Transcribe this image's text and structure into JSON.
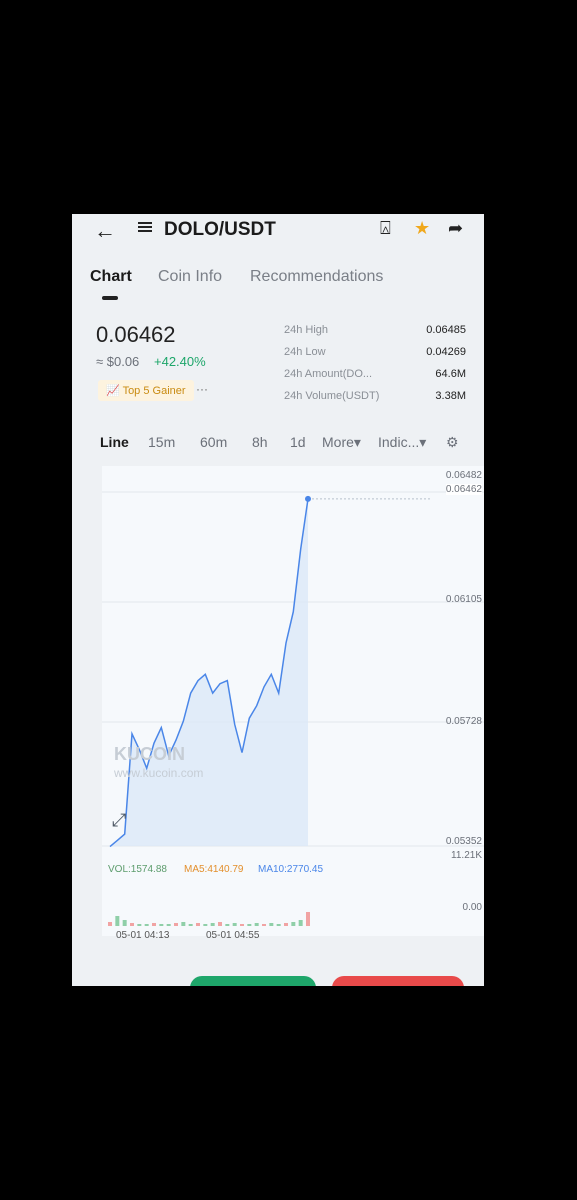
{
  "header": {
    "back_icon": "arrow-left-icon",
    "menu_icon": "hamburger-icon",
    "pair": "DOLO/USDT",
    "alert_icon": "bell-alert-icon",
    "favorite_icon": "star-icon",
    "share_icon": "share-icon",
    "favorite_color": "#f0a81c"
  },
  "tabs": [
    "Chart",
    "Coin Info",
    "Recommendations"
  ],
  "ticker": {
    "price": "0.06462",
    "fiat": "≈ $0.06",
    "change": "+42.40%",
    "badge": "Top 5 Gainer",
    "more": "···"
  },
  "stats": [
    {
      "label": "24h High",
      "value": "0.06485"
    },
    {
      "label": "24h Low",
      "value": "0.04269"
    },
    {
      "label": "24h Amount(DO...",
      "value": "64.6M"
    },
    {
      "label": "24h Volume(USDT)",
      "value": "3.38M"
    }
  ],
  "timeframes": [
    "Line",
    "15m",
    "60m",
    "8h",
    "1d",
    "More",
    "Indic..."
  ],
  "chart_data": {
    "type": "line",
    "y_ticks": [
      "0.06482",
      "0.06105",
      "0.05728",
      "0.05352"
    ],
    "last_price": "0.06462",
    "volume_label": "VOL:1574.88",
    "ma5_label": "MA5:4140.79",
    "ma10_label": "MA10:2770.45",
    "vol_max": "11.21K",
    "vol_min": "0.00",
    "x_ticks": [
      "05-01 04:13",
      "05-01 04:55"
    ],
    "series": [
      {
        "values": [
          0.0535,
          0.0537,
          0.0539,
          0.0571,
          0.0566,
          0.056,
          0.0568,
          0.0573,
          0.0564,
          0.0569,
          0.0575,
          0.0584,
          0.0588,
          0.059,
          0.0584,
          0.0587,
          0.0588,
          0.0574,
          0.0565,
          0.0576,
          0.058,
          0.0586,
          0.059,
          0.0584,
          0.06,
          0.061,
          0.063,
          0.0646
        ]
      }
    ],
    "line_color": "#4a86e8"
  },
  "watermark": {
    "brand": "KUCOIN",
    "url": "www.kucoin.com"
  },
  "colors": {
    "up": "#1ea66a",
    "down": "#e84a4a"
  }
}
